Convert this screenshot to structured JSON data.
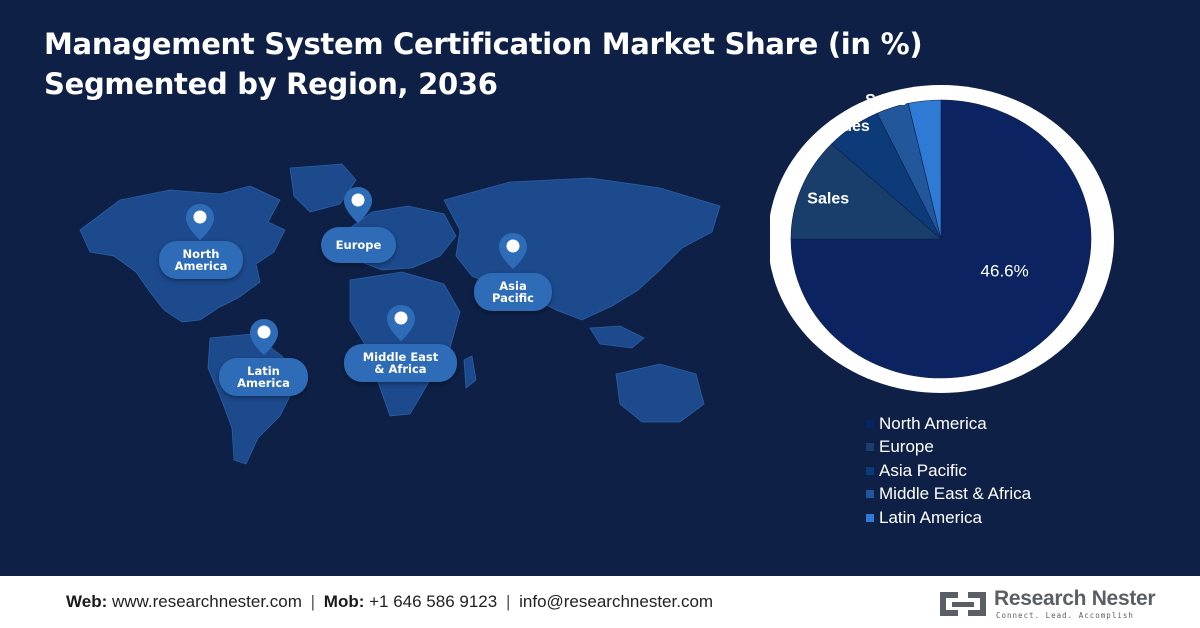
{
  "title": {
    "line1": "Management System Certification Market Share (in %)",
    "line2": "Segmented by Region, 2036"
  },
  "map_labels": {
    "north_america": [
      "North",
      "America"
    ],
    "europe": [
      "Europe"
    ],
    "asia_pacific": [
      "Asia",
      "Pacific"
    ],
    "middle_east_africa": [
      "Middle East",
      "& Africa"
    ],
    "latin_america": [
      "Latin",
      "America"
    ]
  },
  "chart_data": {
    "type": "pie",
    "title": "Management System Certification Market Share (in %) Segmented by Region, 2036",
    "slices": [
      {
        "name": "North America",
        "value": 75.0,
        "label": "46.6%",
        "color": "#0b2461"
      },
      {
        "name": "Europe",
        "value": 12.0,
        "label": "Sales",
        "color": "#193e6c"
      },
      {
        "name": "Asia Pacific",
        "value": 6.0,
        "label": "Sales",
        "color": "#0d3a78"
      },
      {
        "name": "Middle East & Africa",
        "value": 3.5,
        "label": "Sales",
        "color": "#22579c"
      },
      {
        "name": "Latin America",
        "value": 3.5,
        "label": "",
        "color": "#2f7ad4"
      }
    ],
    "legend": [
      "North America",
      "Europe",
      "Asia Pacific",
      "Middle East & Africa",
      "Latin America"
    ],
    "legend_position": "bottom-right"
  },
  "footer": {
    "web_label": "Web:",
    "web_value": "www.researchnester.com",
    "mob_label": "Mob:",
    "mob_value": "+1 646 586 9123",
    "email_value": "info@researchnester.com",
    "separator": "|",
    "logo_name": "Research Nester",
    "logo_tagline": "Connect. Lead. Accomplish"
  },
  "colors": {
    "background": "#0e2045",
    "map": "#1c4a8c",
    "pin_label": "#2f6cb8",
    "pie_ring": "#ffffff"
  }
}
